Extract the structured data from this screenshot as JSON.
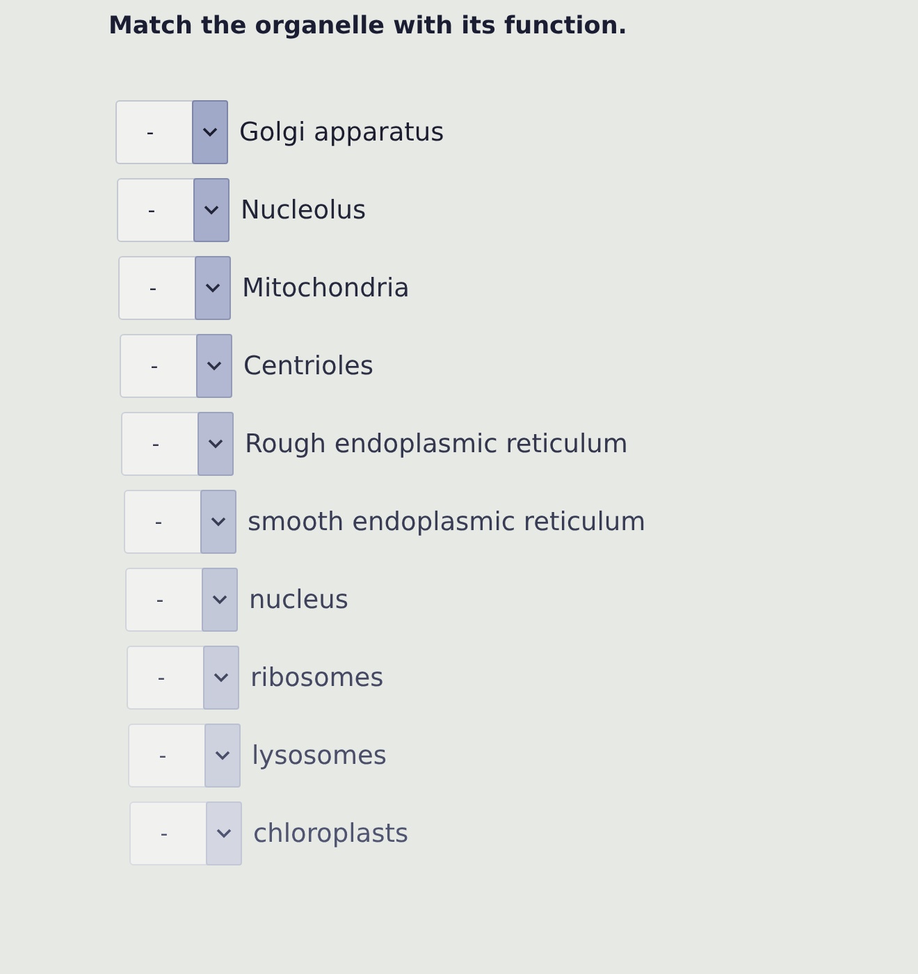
{
  "title": "Match the organelle with its function.",
  "items": [
    {
      "value": "-",
      "label": "Golgi apparatus"
    },
    {
      "value": "-",
      "label": "Nucleolus"
    },
    {
      "value": "-",
      "label": "Mitochondria"
    },
    {
      "value": "-",
      "label": "Centrioles"
    },
    {
      "value": "-",
      "label": "Rough endoplasmic reticulum"
    },
    {
      "value": "-",
      "label": "smooth endoplasmic reticulum"
    },
    {
      "value": "-",
      "label": "nucleus"
    },
    {
      "value": "-",
      "label": "ribosomes"
    },
    {
      "value": "-",
      "label": "lysosomes"
    },
    {
      "value": "-",
      "label": "chloroplasts"
    }
  ]
}
